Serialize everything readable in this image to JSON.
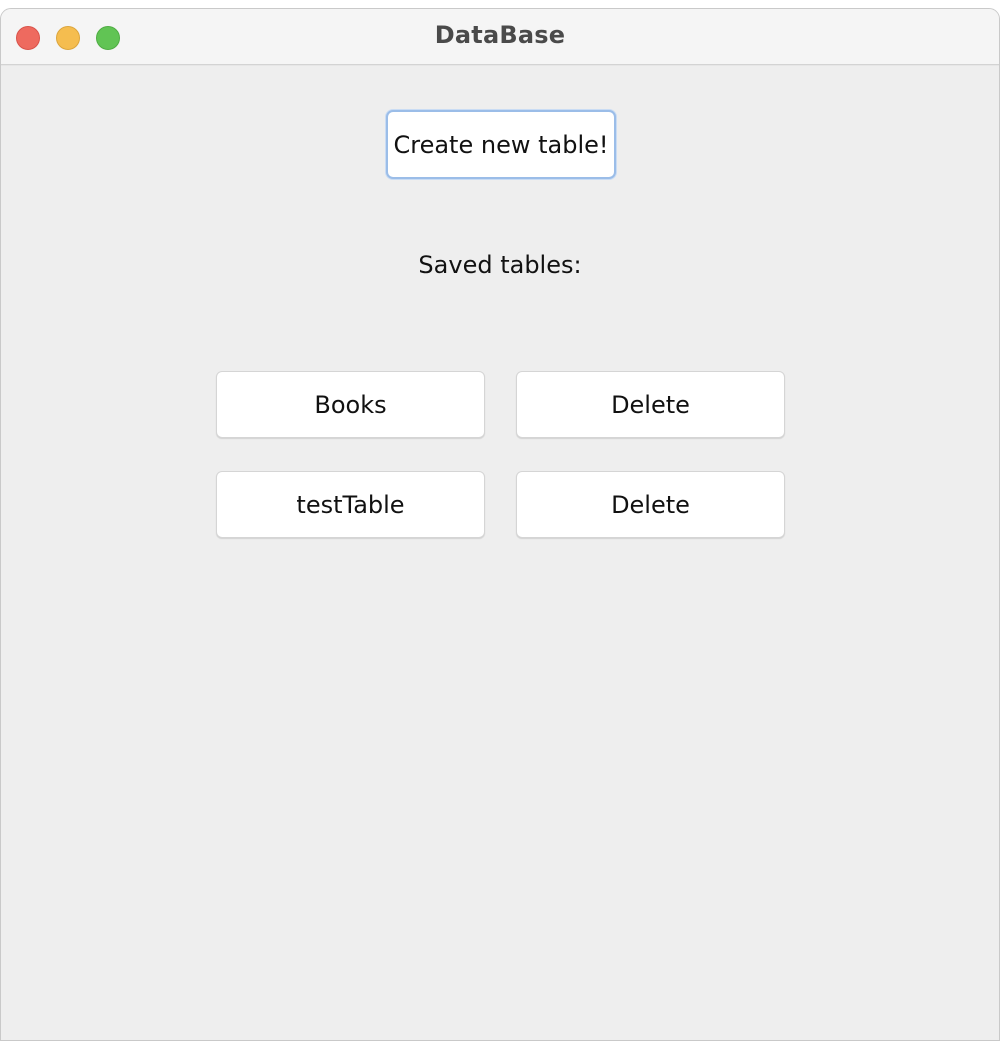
{
  "window": {
    "title": "DataBase"
  },
  "main": {
    "create_button_label": "Create new table!",
    "saved_label": "Saved tables:",
    "tables": [
      {
        "name": "Books",
        "delete_label": "Delete"
      },
      {
        "name": "testTable",
        "delete_label": "Delete"
      }
    ]
  },
  "colors": {
    "window_background": "#eeeeee",
    "titlebar_background": "#f5f5f5",
    "close": "#ee6a5f",
    "minimize": "#f5bd4f",
    "zoom": "#61c454",
    "focus_ring": "#9bbde8"
  }
}
